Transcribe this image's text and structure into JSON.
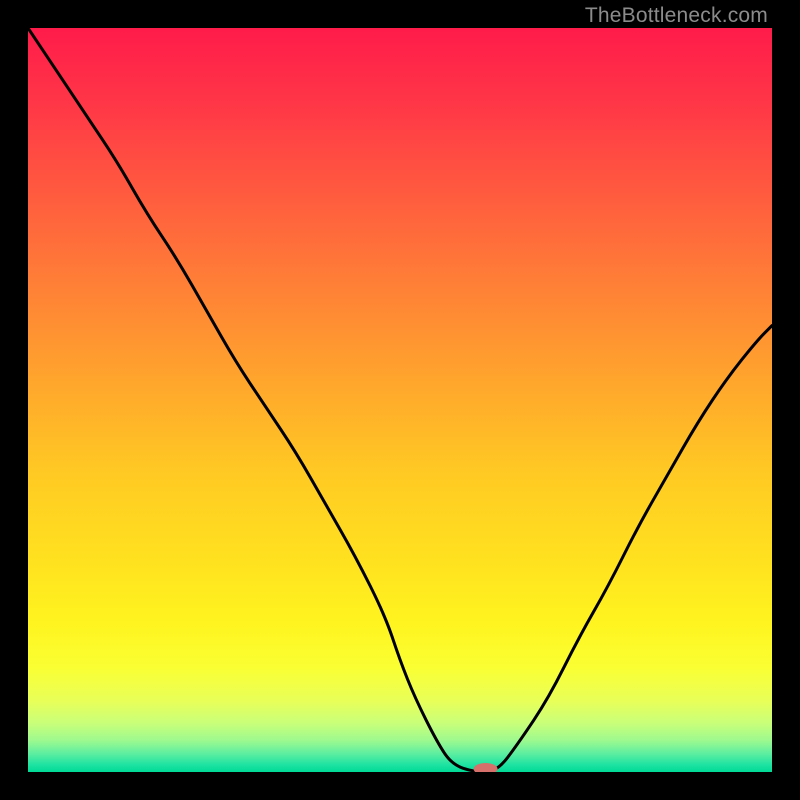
{
  "watermark": "TheBottleneck.com",
  "chart_data": {
    "type": "line",
    "title": "",
    "xlabel": "",
    "ylabel": "",
    "xlim": [
      0,
      100
    ],
    "ylim": [
      0,
      100
    ],
    "grid": false,
    "legend": false,
    "series": [
      {
        "name": "bottleneck-curve",
        "x": [
          0,
          4,
          8,
          12,
          16,
          20,
          24,
          28,
          32,
          36,
          40,
          44,
          48,
          50,
          52,
          55,
          57,
          60,
          63,
          66,
          70,
          74,
          78,
          82,
          86,
          90,
          94,
          98,
          100
        ],
        "y": [
          100,
          94,
          88,
          82,
          75,
          69,
          62,
          55,
          49,
          43,
          36,
          29,
          21,
          15,
          10,
          4,
          1,
          0,
          0,
          4,
          10,
          18,
          25,
          33,
          40,
          47,
          53,
          58,
          60
        ]
      }
    ],
    "marker": {
      "name": "optimal-point",
      "x": 61.5,
      "y": 0,
      "color": "#d6706b",
      "rx": 12,
      "ry": 6
    },
    "background_gradient": {
      "stops": [
        {
          "offset": 0.0,
          "color": "#ff1b4a"
        },
        {
          "offset": 0.1,
          "color": "#ff3647"
        },
        {
          "offset": 0.22,
          "color": "#ff5a3f"
        },
        {
          "offset": 0.35,
          "color": "#ff8136"
        },
        {
          "offset": 0.48,
          "color": "#ffa72c"
        },
        {
          "offset": 0.6,
          "color": "#ffca23"
        },
        {
          "offset": 0.72,
          "color": "#ffe21f"
        },
        {
          "offset": 0.8,
          "color": "#fff41f"
        },
        {
          "offset": 0.86,
          "color": "#faff33"
        },
        {
          "offset": 0.905,
          "color": "#e8ff59"
        },
        {
          "offset": 0.935,
          "color": "#c8ff7a"
        },
        {
          "offset": 0.958,
          "color": "#9cf98f"
        },
        {
          "offset": 0.975,
          "color": "#5eeea0"
        },
        {
          "offset": 0.99,
          "color": "#1fe3a2"
        },
        {
          "offset": 1.0,
          "color": "#00da96"
        }
      ]
    }
  }
}
